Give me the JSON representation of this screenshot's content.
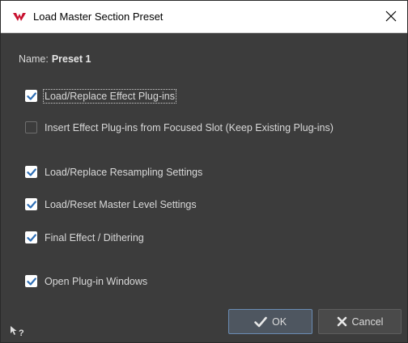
{
  "window": {
    "title": "Load Master Section Preset",
    "close_glyph": "✕"
  },
  "name_row": {
    "label": "Name:",
    "value": "Preset 1"
  },
  "options": [
    {
      "label": "Load/Replace Effect Plug-ins",
      "checked": true,
      "focused": true
    },
    {
      "label": "Insert Effect Plug-ins from Focused Slot (Keep Existing Plug-ins)",
      "checked": false,
      "focused": false
    },
    {
      "label": "Load/Replace Resampling Settings",
      "checked": true,
      "focused": false
    },
    {
      "label": "Load/Reset Master Level Settings",
      "checked": true,
      "focused": false
    },
    {
      "label": "Final Effect / Dithering",
      "checked": true,
      "focused": false
    },
    {
      "label": "Open Plug-in Windows",
      "checked": true,
      "focused": false
    }
  ],
  "buttons": {
    "ok_label": "OK",
    "cancel_label": "Cancel"
  },
  "colors": {
    "window_bg": "#3c3c3c",
    "checkbox_check": "#2f6fb5",
    "ok_border": "#6a8cb3",
    "app_icon": "#c8102e"
  },
  "icons": {
    "app": "wavelab-logo-icon",
    "check": "checkmark-icon",
    "cancel": "x-icon",
    "help": "whats-this-help-icon"
  }
}
